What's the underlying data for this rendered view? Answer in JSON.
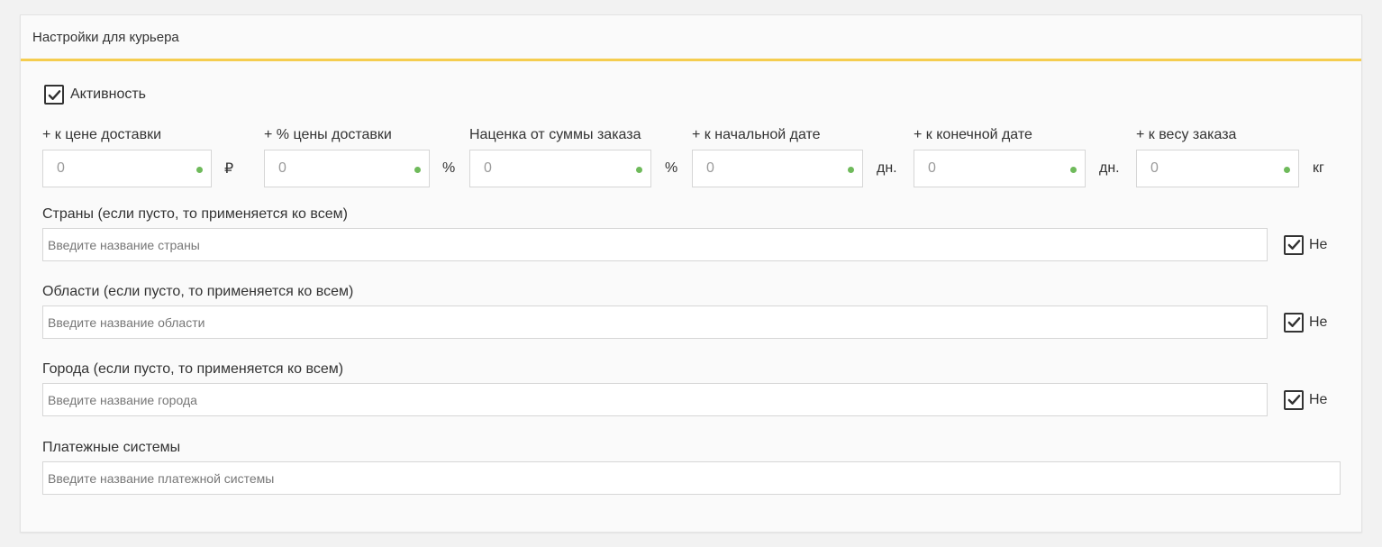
{
  "panel": {
    "title": "Настройки для курьера"
  },
  "active": {
    "label": "Активность",
    "checked": true
  },
  "modifiers": [
    {
      "label": "+ к цене доставки",
      "value": "0",
      "unit": "₽"
    },
    {
      "label": "+ % цены доставки",
      "value": "0",
      "unit": "%"
    },
    {
      "label": "Наценка от суммы заказа",
      "value": "0",
      "unit": "%"
    },
    {
      "label": "+ к начальной дате",
      "value": "0",
      "unit": "дн."
    },
    {
      "label": "+ к конечной дате",
      "value": "0",
      "unit": "дн."
    },
    {
      "label": "+ к весу заказа",
      "value": "0",
      "unit": "кг"
    }
  ],
  "countries": {
    "label": "Страны (если пусто, то применяется ко всем)",
    "placeholder": "Введите название страны",
    "not_label": "Не",
    "not_checked": true
  },
  "regions": {
    "label": "Области (если пусто, то применяется ко всем)",
    "placeholder": "Введите название области",
    "not_label": "Не",
    "not_checked": true
  },
  "cities": {
    "label": "Города (если пусто, то применяется ко всем)",
    "placeholder": "Введите название города",
    "not_label": "Не",
    "not_checked": true
  },
  "payment": {
    "label": "Платежные системы",
    "placeholder": "Введите название платежной системы"
  },
  "colors": {
    "accent": "#f5cd4f",
    "status_dot": "#6fba5b"
  }
}
